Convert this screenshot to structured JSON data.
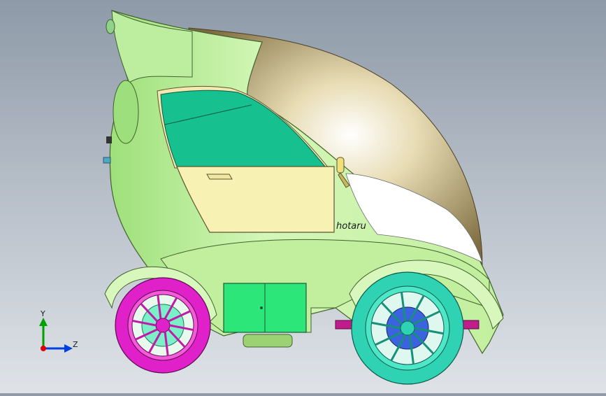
{
  "viewport": {
    "background_top": "#8e9aa8",
    "background_bottom": "#dfe3e8"
  },
  "model": {
    "brand_label": "hotaru",
    "colors": {
      "body": "#c9f2a8",
      "body_edge": "#4d6b3a",
      "roof": "#8f7d4e",
      "window": "#16c08f",
      "door": "#f7f2b4",
      "front_wheel": "#e020c8",
      "rear_wheel": "#2fd3b4",
      "hub": "#3b63e0",
      "panel": "#2de67a"
    }
  },
  "triad": {
    "y_label": "Y",
    "z_label": "Z",
    "colors": {
      "x": "#e00000",
      "y": "#00a000",
      "z": "#0040e0"
    }
  }
}
